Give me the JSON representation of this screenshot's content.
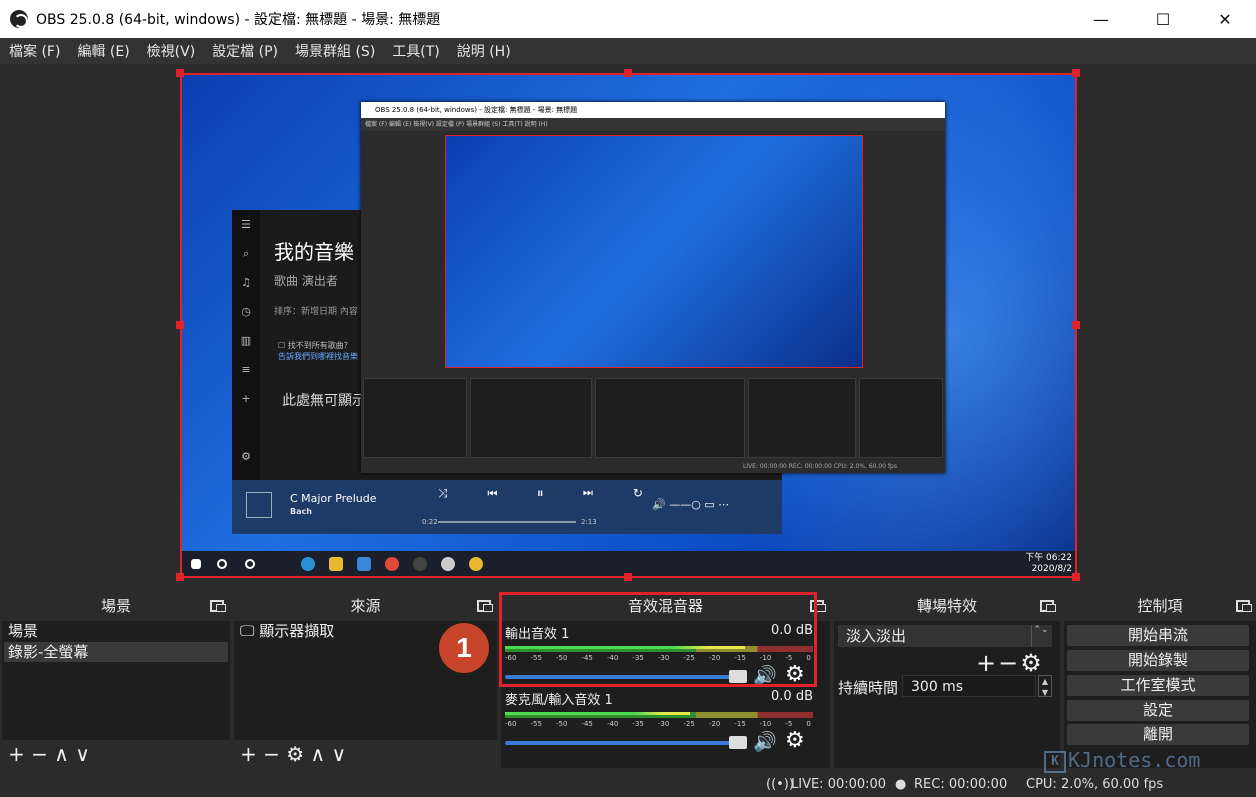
{
  "window": {
    "title": "OBS 25.0.8 (64-bit, windows) - 設定檔: 無標題 - 場景: 無標題",
    "minimize": "—",
    "maximize": "☐",
    "close": "✕"
  },
  "menu": [
    "檔案 (F)",
    "編輯 (E)",
    "檢視(V)",
    "設定檔 (P)",
    "場景群組 (S)",
    "工具(T)",
    "說明 (H)"
  ],
  "preview": {
    "music_app": {
      "title": "我的音樂",
      "tabs": "歌曲     演出者",
      "sort": "排序：新增日期     內容",
      "check": "找不到所有歌曲？",
      "check_link": "告訴我們到哪裡找音樂",
      "empty": "此處無可顯示項",
      "song": "C Major Prelude",
      "artist": "Bach",
      "time_start": "0:22",
      "time_end": "2:13",
      "controls": "⤨ ⏮ ⏸ ⏭ ↻"
    },
    "nested": {
      "title": "OBS 25.0.8 (64-bit, windows) - 設定檔: 無標題 - 場景: 無標題",
      "menu": "檔案 (F)   編輯 (E)   檢視(V)   設定檔 (P)   場景群組 (S)   工具(T)   說明 (H)",
      "status": "LIVE: 00:00:00    REC: 00:00:00    CPU: 2.0%, 60.00 fps"
    },
    "taskbar_clock": [
      "下午 06:22",
      "2020/8/2"
    ]
  },
  "scenes": {
    "header": "場景",
    "items": [
      "場景",
      "錄影-全螢幕"
    ],
    "tools": "+ − ∧ ∨"
  },
  "sources": {
    "header": "來源",
    "items": [
      "顯示器擷取"
    ],
    "tools": "+ − ⚙ ∧ ∨"
  },
  "mixer": {
    "header": "音效混音器",
    "tracks": [
      {
        "name": "輸出音效 1",
        "db": "0.0 dB",
        "level": 0.78
      },
      {
        "name": "麥克風/輸入音效 1",
        "db": "0.0 dB",
        "level": 0.6
      }
    ],
    "ticks": [
      "-60",
      "-55",
      "-50",
      "-45",
      "-40",
      "-35",
      "-30",
      "-25",
      "-20",
      "-15",
      "-10",
      "-5",
      "0"
    ],
    "badge": "1"
  },
  "transitions": {
    "header": "轉場特效",
    "selected": "淡入淡出",
    "duration_label": "持續時間",
    "duration_value": "300 ms",
    "tools": "+−⚙"
  },
  "controls": {
    "header": "控制項",
    "buttons": [
      "開始串流",
      "開始錄製",
      "工作室模式",
      "設定",
      "離開"
    ]
  },
  "status": {
    "live": "LIVE: 00:00:00",
    "rec": "REC: 00:00:00",
    "cpu": "CPU: 2.0%, 60.00 fps"
  },
  "watermark": "KJnotes.com",
  "colors": {
    "accent_red": "#e0232a",
    "badge": "#c8442a",
    "volume_blue": "#3a7bd5"
  }
}
